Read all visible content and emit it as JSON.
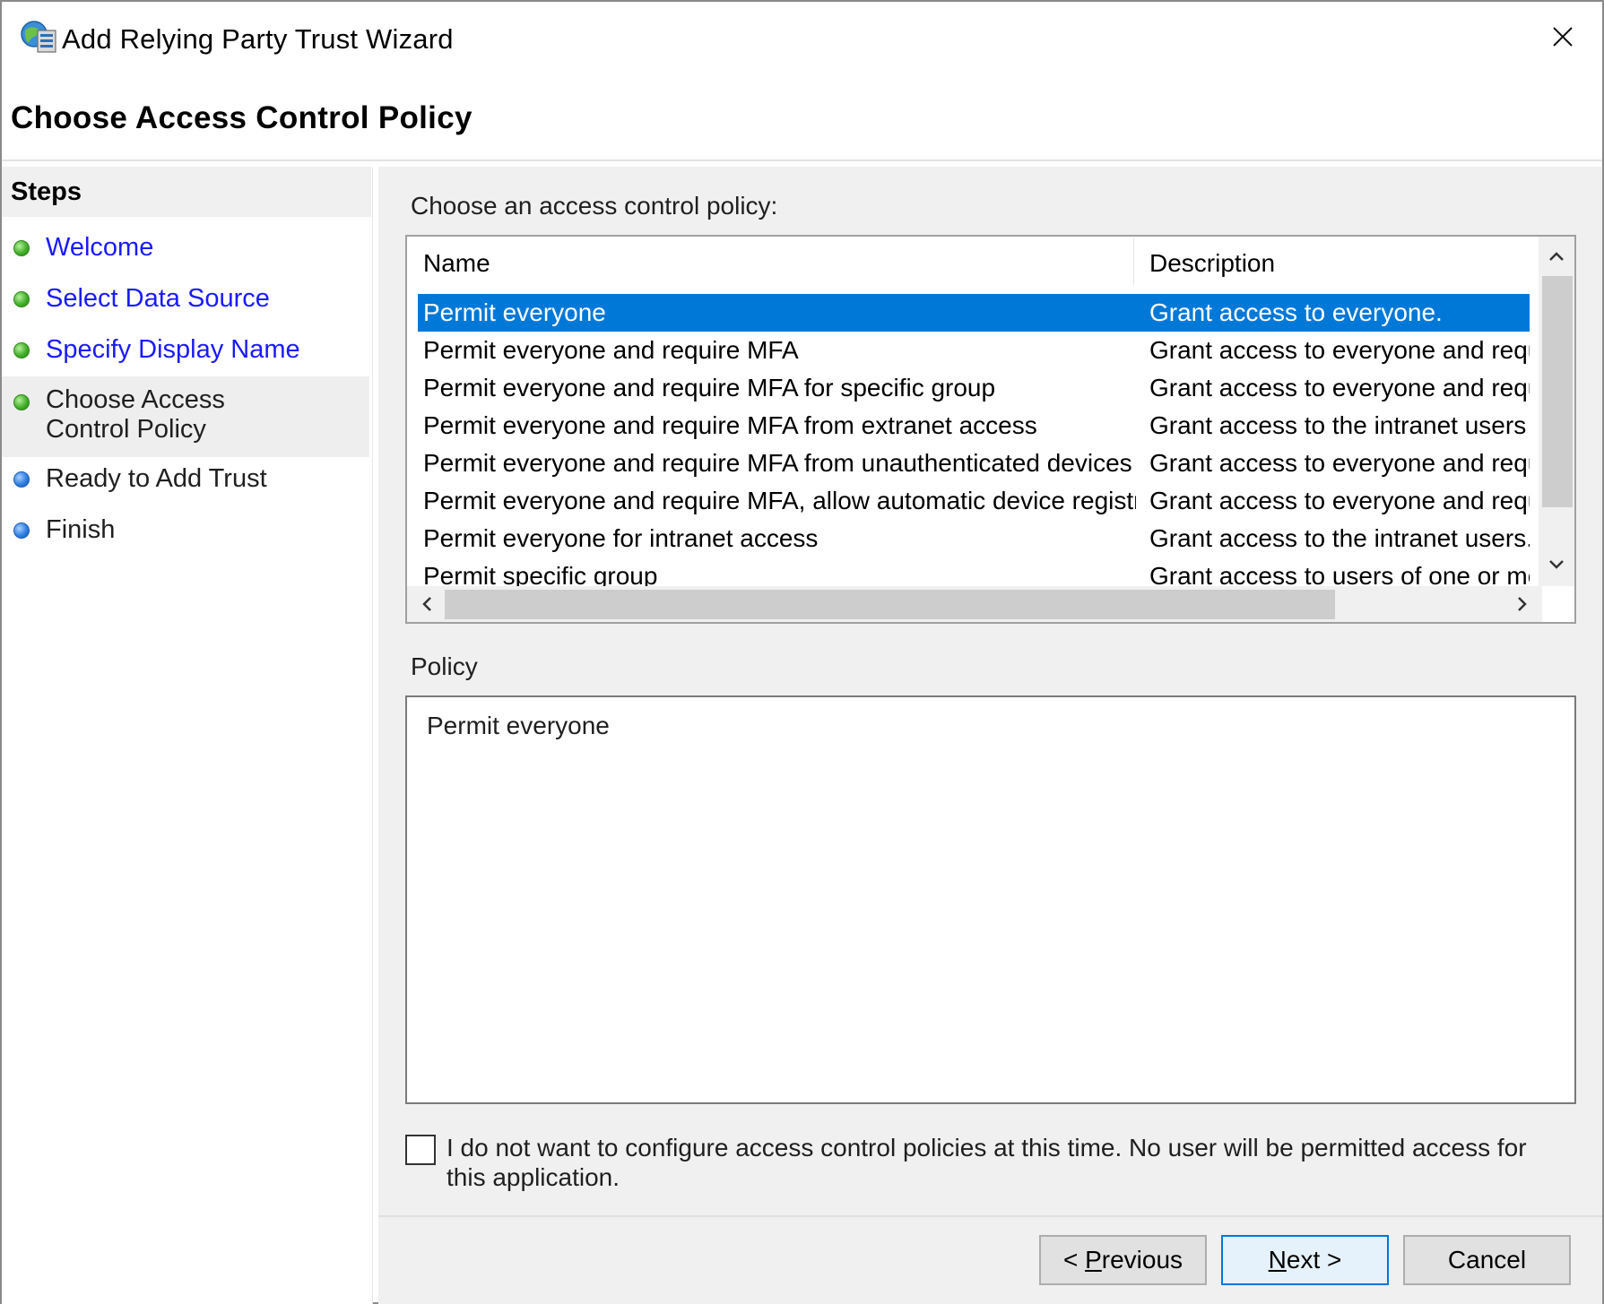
{
  "window": {
    "title": "Add Relying Party Trust Wizard",
    "close_symbol": "✕"
  },
  "header": {
    "title": "Choose Access Control Policy"
  },
  "sidebar": {
    "header": "Steps",
    "items": [
      {
        "label": "Welcome",
        "status": "complete"
      },
      {
        "label": "Select Data Source",
        "status": "complete"
      },
      {
        "label": "Specify Display Name",
        "status": "complete"
      },
      {
        "label": "Choose Access Control Policy",
        "status": "current"
      },
      {
        "label": "Ready to Add Trust",
        "status": "pending"
      },
      {
        "label": "Finish",
        "status": "pending"
      }
    ]
  },
  "main": {
    "choose_label": "Choose an access control policy:",
    "columns": {
      "name": "Name",
      "description": "Description"
    },
    "rows": [
      {
        "name": "Permit everyone",
        "description": "Grant access to everyone.",
        "selected": true
      },
      {
        "name": "Permit everyone and require MFA",
        "description": "Grant access to everyone and require"
      },
      {
        "name": "Permit everyone and require MFA for specific group",
        "description": "Grant access to everyone and require"
      },
      {
        "name": "Permit everyone and require MFA from extranet access",
        "description": "Grant access to the intranet users an"
      },
      {
        "name": "Permit everyone and require MFA from unauthenticated devices",
        "description": "Grant access to everyone and require"
      },
      {
        "name": "Permit everyone and require MFA, allow automatic device registra...",
        "description": "Grant access to everyone and require"
      },
      {
        "name": "Permit everyone for intranet access",
        "description": "Grant access to the intranet users."
      },
      {
        "name": "Permit specific group",
        "description": "Grant access to users of one or more"
      }
    ],
    "policy_label": "Policy",
    "policy_text": "Permit everyone",
    "checkbox_label": "I do not want to configure access control policies at this time. No user will be permitted access for this application.",
    "checkbox_checked": false
  },
  "footer": {
    "previous_prefix": "< ",
    "previous_mnemonic": "P",
    "previous_rest": "revious",
    "next_mnemonic": "N",
    "next_rest": "ext >",
    "cancel": "Cancel"
  },
  "colors": {
    "selection": "#0078d7",
    "link": "#1a1aff",
    "panel_bg": "#f0f0f0"
  }
}
